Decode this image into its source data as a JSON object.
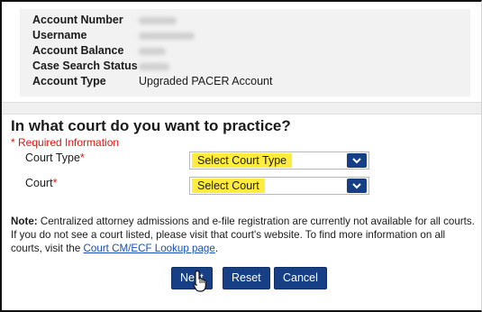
{
  "account": {
    "rows": [
      {
        "label": "Account Number",
        "value": ""
      },
      {
        "label": "Username",
        "value": ""
      },
      {
        "label": "Account Balance",
        "value": ""
      },
      {
        "label": "Case Search Status",
        "value": ""
      },
      {
        "label": "Account Type",
        "value": "Upgraded PACER Account"
      }
    ]
  },
  "form": {
    "heading": "In what court do you want to practice?",
    "required_note": "* Required Information",
    "court_type": {
      "label": "Court Type",
      "star": "*",
      "selected": "Select Court Type"
    },
    "court": {
      "label": "Court",
      "star": "*",
      "selected": "Select Court"
    },
    "note": {
      "prefix": "Note:",
      "text": " Centralized attorney admissions and e-file registration are currently not available for all courts. If you do not see a court listed, please visit that court's website. To find more information on all courts, visit the ",
      "link": "Court CM/ECF Lookup page",
      "suffix": "."
    }
  },
  "buttons": {
    "next": "Next",
    "reset": "Reset",
    "cancel": "Cancel"
  },
  "colors": {
    "primary": "#163f86",
    "required": "#e0160f",
    "highlight": "#ffec3d",
    "link": "#1a4fb5"
  },
  "icons": {
    "select_caret": "chevron-down-icon",
    "cursor": "hand-pointer-icon"
  }
}
